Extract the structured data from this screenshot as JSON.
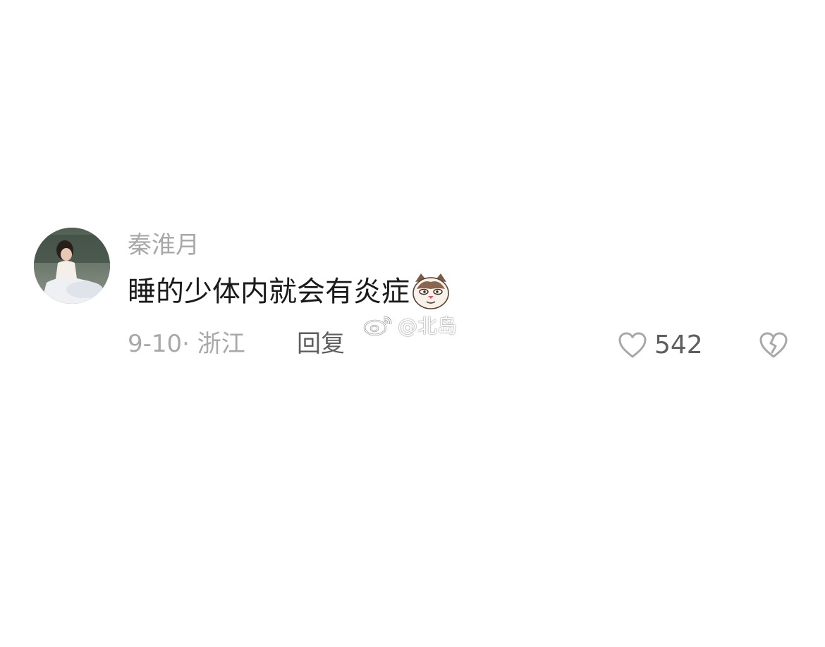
{
  "comment": {
    "username": "秦淮月",
    "text": "睡的少体内就会有炎症",
    "emoji_icon": "cat-face-emoji",
    "date_location": "9-10· 浙江",
    "reply_label": "回复",
    "like_count": "542",
    "like_icon": "heart-outline-icon",
    "dislike_icon": "broken-heart-icon"
  },
  "watermark": {
    "icon": "weibo-logo-icon",
    "text": "@北岛"
  }
}
